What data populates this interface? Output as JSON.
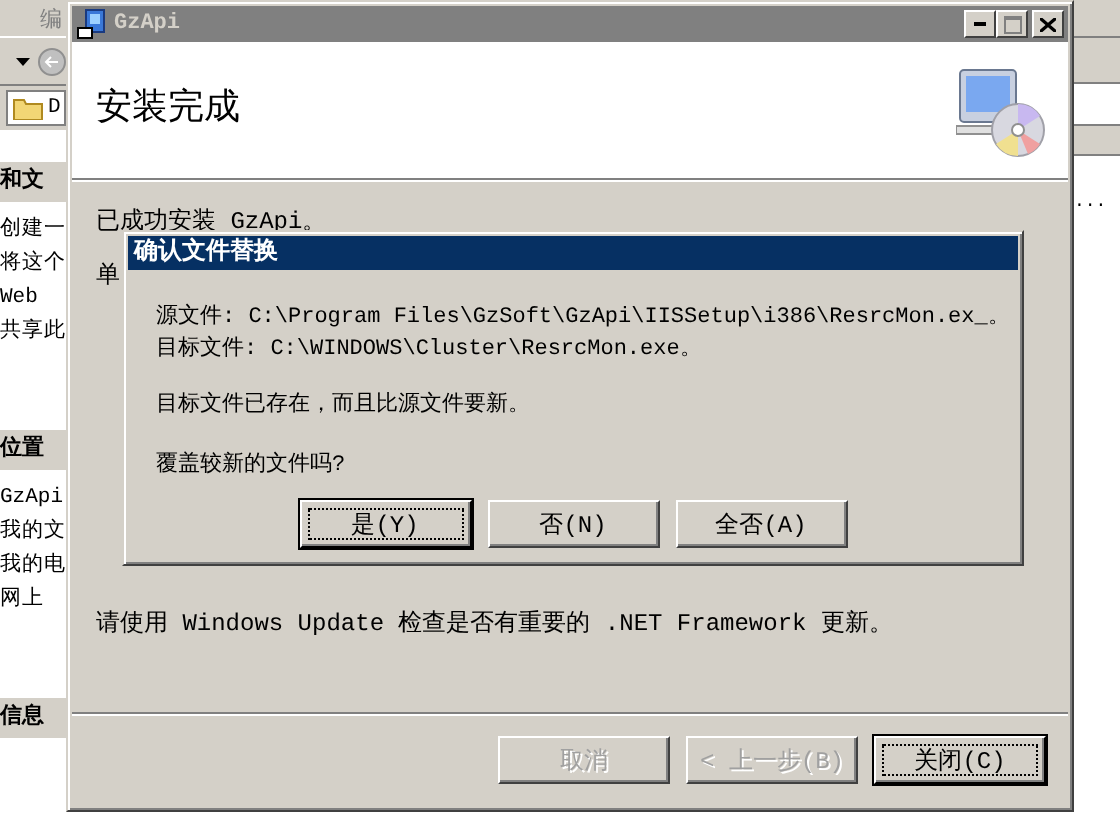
{
  "background_window": {
    "menu": [
      "编"
    ],
    "address": "D",
    "sections": [
      {
        "title": "和文",
        "items": [
          "创建一",
          "将这个",
          "Web",
          "共享此"
        ]
      },
      {
        "title": "位置",
        "items": [
          "GzApi",
          "我的文",
          "我的电",
          "网上"
        ]
      },
      {
        "title": "信息"
      }
    ],
    "right_edge_text": "..."
  },
  "setup_window": {
    "title": "GzApi",
    "heading": "安装完成",
    "message": "已成功安装 GzApi。",
    "covered_line": "单",
    "note": "请使用 Windows Update 检查是否有重要的 .NET Framework 更新。",
    "buttons": [
      {
        "label": "取消",
        "disabled": true,
        "default": false
      },
      {
        "label": "< 上一步(B)",
        "disabled": true,
        "default": false
      },
      {
        "label": "关闭(C)",
        "disabled": false,
        "default": true
      }
    ]
  },
  "dialog": {
    "title": "确认文件替换",
    "source": "源文件: C:\\Program Files\\GzSoft\\GzApi\\IISSetup\\i386\\ResrcMon.ex_。",
    "target": "目标文件: C:\\WINDOWS\\Cluster\\ResrcMon.exe。",
    "message": "目标文件已存在，而且比源文件要新。",
    "question": "覆盖较新的文件吗?",
    "buttons": [
      {
        "label": "是(Y)",
        "default": true
      },
      {
        "label": "否(N)",
        "default": false
      },
      {
        "label": "全否(A)",
        "default": false
      }
    ]
  }
}
